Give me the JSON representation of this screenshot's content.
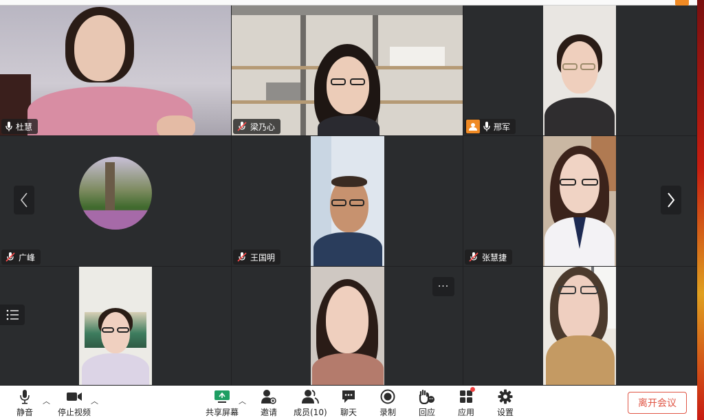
{
  "participants": [
    {
      "name": "杜慧",
      "mic": "on"
    },
    {
      "name": "梁乃心",
      "mic": "muted"
    },
    {
      "name": "邢军",
      "mic": "on",
      "host": true
    },
    {
      "name": "广峰",
      "mic": "muted"
    },
    {
      "name": "王国明",
      "mic": "muted"
    },
    {
      "name": "张慧捷",
      "mic": "muted"
    }
  ],
  "toolbar": {
    "mute": "静音",
    "stop_video": "停止视频",
    "share_screen": "共享屏幕",
    "invite": "邀请",
    "members": "成员(10)",
    "chat": "聊天",
    "record": "录制",
    "react": "回应",
    "apps": "应用",
    "settings": "设置",
    "leave": "离开会议"
  },
  "more_glyph": "···",
  "colors": {
    "accent": "#f08a24",
    "leave": "#e05545",
    "tile_bg": "#2a2c2e"
  }
}
